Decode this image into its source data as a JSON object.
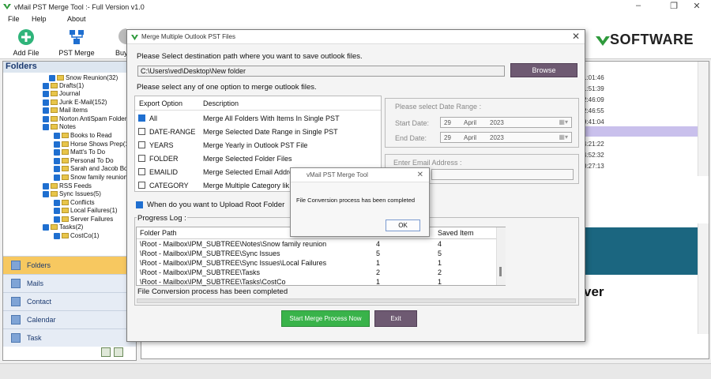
{
  "app": {
    "title": "vMail PST Merge Tool :- Full Version v1.0"
  },
  "menu": [
    "File",
    "Help",
    "About"
  ],
  "toolbar": {
    "add_file": "Add File",
    "pst_merge": "PST Merge",
    "buy": "Buy",
    "brand": "SOFTWARE"
  },
  "sidebar": {
    "header": "Folders",
    "tree": [
      "Snow Reunion(32)",
      "Drafts(1)",
      "Journal",
      "Junk E-Mail(152)",
      "Mail items",
      "Norton AntiSpam Folder",
      "Notes",
      "Books to Read",
      "Horse Shows Prep(1)",
      "Matt's To Do",
      "Personal To Do",
      "Sarah and Jacob Boo",
      "Snow family reunion(4",
      "RSS Feeds",
      "Sync Issues(5)",
      "Conflicts",
      "Local Failures(1)",
      "Server Failures",
      "Tasks(2)",
      "CostCo(1)"
    ],
    "nav": [
      "Folders",
      "Mails",
      "Contact",
      "Calendar",
      "Task"
    ]
  },
  "right_panel": {
    "times": [
      "1:01:46",
      "1:51:39",
      "2:46:09",
      "2:46:55",
      "9:41:04",
      "4:21:22",
      "4:52:32",
      "0:27:13"
    ],
    "partial_word": "ver"
  },
  "dialog": {
    "title": "Merge Multiple Outlook PST Files",
    "dest_label": "Please Select destination path where you want to save outlook files.",
    "dest_path": "C:\\Users\\ved\\Desktop\\New folder",
    "browse": "Browse",
    "option_label": "Please select any of one option to merge outlook files.",
    "col_export": "Export Option",
    "col_desc": "Description",
    "options": [
      {
        "name": "All",
        "desc": "Merge All Folders With Items In Single PST",
        "checked": true
      },
      {
        "name": "DATE-RANGE",
        "desc": "Merge Selected Date Range in Single PST",
        "checked": false
      },
      {
        "name": "YEARS",
        "desc": "Merge Yearly in Outlook PST File",
        "checked": false
      },
      {
        "name": "FOLDER",
        "desc": "Merge Selected Folder Files",
        "checked": false
      },
      {
        "name": "EMAILID",
        "desc": "Merge Selected Email Addre",
        "checked": false
      },
      {
        "name": "CATEGORY",
        "desc": "Merge Multiple Category lik",
        "checked": false
      }
    ],
    "date_range_label": "Please select Date Range :",
    "start_label": "Start Date:",
    "end_label": "End Date:",
    "start_date": {
      "day": "29",
      "month": "April",
      "year": "2023"
    },
    "end_date": {
      "day": "29",
      "month": "April",
      "year": "2023"
    },
    "email_label": "Enter Email Address :",
    "root_folder_label": "When do you want to Upload Root Folder",
    "progress_label": "Progress Log :",
    "log_col_path": "Folder Path",
    "log_col_saved": "Saved Item",
    "log_rows": [
      {
        "path": "\\Root - Mailbox\\IPM_SUBTREE\\Notes\\Snow family reunion",
        "n1": "4",
        "n2": "4"
      },
      {
        "path": "\\Root - Mailbox\\IPM_SUBTREE\\Sync Issues",
        "n1": "5",
        "n2": "5"
      },
      {
        "path": "\\Root - Mailbox\\IPM_SUBTREE\\Sync Issues\\Local Failures",
        "n1": "1",
        "n2": "1"
      },
      {
        "path": "\\Root - Mailbox\\IPM_SUBTREE\\Tasks",
        "n1": "2",
        "n2": "2"
      },
      {
        "path": "\\Root - Mailbox\\IPM_SUBTREE\\Tasks\\CostCo",
        "n1": "1",
        "n2": "1"
      }
    ],
    "status": "File Conversion process has been completed",
    "start_btn": "Start Merge Process Now",
    "exit_btn": "Exit"
  },
  "popup": {
    "title": "vMail PST Merge Tool",
    "message": "File Conversion process has been completed",
    "ok": "OK"
  },
  "colors": {
    "accent_green": "#39b34a",
    "button_purple": "#6e5a72",
    "nav_active": "#f7c860"
  }
}
